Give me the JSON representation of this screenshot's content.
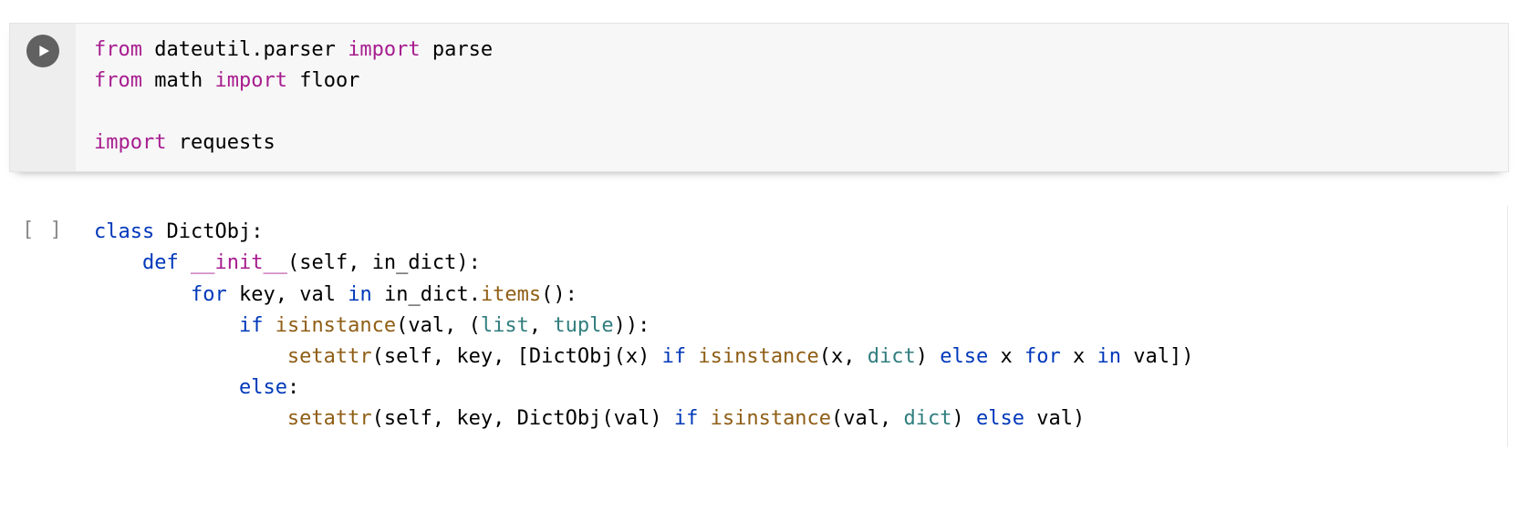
{
  "cells": [
    {
      "state": "active",
      "exec_display": "",
      "tokens": [
        [
          {
            "t": "from",
            "c": "kw-import"
          },
          {
            "t": " "
          },
          {
            "t": "dateutil",
            "c": "name-plain"
          },
          {
            "t": "."
          },
          {
            "t": "parser",
            "c": "name-plain"
          },
          {
            "t": " "
          },
          {
            "t": "import",
            "c": "kw-import"
          },
          {
            "t": " "
          },
          {
            "t": "parse",
            "c": "name-plain"
          }
        ],
        [
          {
            "t": "from",
            "c": "kw-import"
          },
          {
            "t": " "
          },
          {
            "t": "math",
            "c": "name-plain"
          },
          {
            "t": " "
          },
          {
            "t": "import",
            "c": "kw-import"
          },
          {
            "t": " "
          },
          {
            "t": "floor",
            "c": "name-plain"
          }
        ],
        [],
        [
          {
            "t": "import",
            "c": "kw-import"
          },
          {
            "t": " "
          },
          {
            "t": "requests",
            "c": "name-plain"
          }
        ]
      ]
    },
    {
      "state": "idle",
      "exec_display": "[ ]",
      "tokens": [
        [
          {
            "t": "class",
            "c": "kw-class"
          },
          {
            "t": " "
          },
          {
            "t": "DictObj",
            "c": "name-plain"
          },
          {
            "t": ":",
            "c": "punct"
          }
        ],
        [
          {
            "t": "    "
          },
          {
            "t": "def",
            "c": "kw-def"
          },
          {
            "t": " "
          },
          {
            "t": "__init__",
            "c": "name-dunder"
          },
          {
            "t": "(",
            "c": "punct"
          },
          {
            "t": "self",
            "c": "name-param"
          },
          {
            "t": ", ",
            "c": "punct"
          },
          {
            "t": "in_dict",
            "c": "name-param"
          },
          {
            "t": "):",
            "c": "punct"
          }
        ],
        [
          {
            "t": "        "
          },
          {
            "t": "for",
            "c": "kw-flow"
          },
          {
            "t": " "
          },
          {
            "t": "key",
            "c": "name-plain"
          },
          {
            "t": ", ",
            "c": "punct"
          },
          {
            "t": "val",
            "c": "name-plain"
          },
          {
            "t": " "
          },
          {
            "t": "in",
            "c": "kw-flow"
          },
          {
            "t": " "
          },
          {
            "t": "in_dict",
            "c": "name-plain"
          },
          {
            "t": ".",
            "c": "punct"
          },
          {
            "t": "items",
            "c": "name-func"
          },
          {
            "t": "():",
            "c": "punct"
          }
        ],
        [
          {
            "t": "            "
          },
          {
            "t": "if",
            "c": "kw-flow"
          },
          {
            "t": " "
          },
          {
            "t": "isinstance",
            "c": "name-func"
          },
          {
            "t": "(",
            "c": "punct"
          },
          {
            "t": "val",
            "c": "name-plain"
          },
          {
            "t": ", (",
            "c": "punct"
          },
          {
            "t": "list",
            "c": "name-builtin"
          },
          {
            "t": ", ",
            "c": "punct"
          },
          {
            "t": "tuple",
            "c": "name-builtin"
          },
          {
            "t": ")):",
            "c": "punct"
          }
        ],
        [
          {
            "t": "                "
          },
          {
            "t": "setattr",
            "c": "name-func"
          },
          {
            "t": "(",
            "c": "punct"
          },
          {
            "t": "self",
            "c": "name-plain"
          },
          {
            "t": ", ",
            "c": "punct"
          },
          {
            "t": "key",
            "c": "name-plain"
          },
          {
            "t": ", [",
            "c": "punct"
          },
          {
            "t": "DictObj",
            "c": "name-plain"
          },
          {
            "t": "(",
            "c": "punct"
          },
          {
            "t": "x",
            "c": "name-plain"
          },
          {
            "t": ") ",
            "c": "punct"
          },
          {
            "t": "if",
            "c": "kw-flow"
          },
          {
            "t": " "
          },
          {
            "t": "isinstance",
            "c": "name-func"
          },
          {
            "t": "(",
            "c": "punct"
          },
          {
            "t": "x",
            "c": "name-plain"
          },
          {
            "t": ", ",
            "c": "punct"
          },
          {
            "t": "dict",
            "c": "name-builtin"
          },
          {
            "t": ") ",
            "c": "punct"
          },
          {
            "t": "else",
            "c": "kw-flow"
          },
          {
            "t": " "
          },
          {
            "t": "x",
            "c": "name-plain"
          },
          {
            "t": " "
          },
          {
            "t": "for",
            "c": "kw-flow"
          },
          {
            "t": " "
          },
          {
            "t": "x",
            "c": "name-plain"
          },
          {
            "t": " "
          },
          {
            "t": "in",
            "c": "kw-flow"
          },
          {
            "t": " "
          },
          {
            "t": "val",
            "c": "name-plain"
          },
          {
            "t": "])",
            "c": "punct"
          }
        ],
        [
          {
            "t": "            "
          },
          {
            "t": "else",
            "c": "kw-flow"
          },
          {
            "t": ":",
            "c": "punct"
          }
        ],
        [
          {
            "t": "                "
          },
          {
            "t": "setattr",
            "c": "name-func"
          },
          {
            "t": "(",
            "c": "punct"
          },
          {
            "t": "self",
            "c": "name-plain"
          },
          {
            "t": ", ",
            "c": "punct"
          },
          {
            "t": "key",
            "c": "name-plain"
          },
          {
            "t": ", ",
            "c": "punct"
          },
          {
            "t": "DictObj",
            "c": "name-plain"
          },
          {
            "t": "(",
            "c": "punct"
          },
          {
            "t": "val",
            "c": "name-plain"
          },
          {
            "t": ") ",
            "c": "punct"
          },
          {
            "t": "if",
            "c": "kw-flow"
          },
          {
            "t": " "
          },
          {
            "t": "isinstance",
            "c": "name-func"
          },
          {
            "t": "(",
            "c": "punct"
          },
          {
            "t": "val",
            "c": "name-plain"
          },
          {
            "t": ", ",
            "c": "punct"
          },
          {
            "t": "dict",
            "c": "name-builtin"
          },
          {
            "t": ") ",
            "c": "punct"
          },
          {
            "t": "else",
            "c": "kw-flow"
          },
          {
            "t": " "
          },
          {
            "t": "val",
            "c": "name-plain"
          },
          {
            "t": ")",
            "c": "punct"
          }
        ]
      ]
    }
  ]
}
